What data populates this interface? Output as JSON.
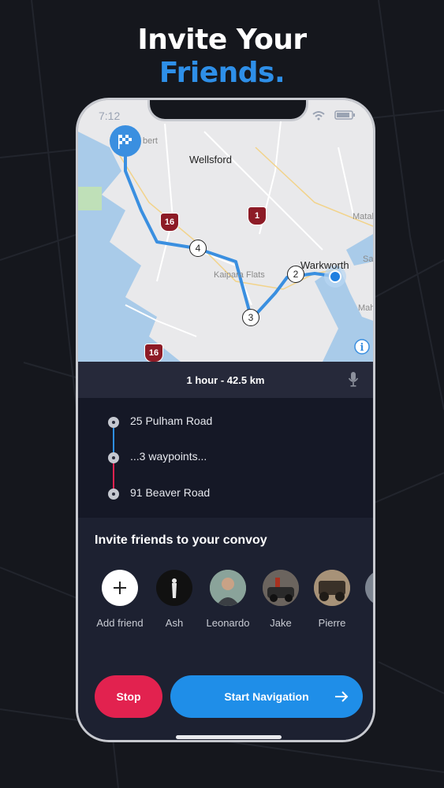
{
  "headline": {
    "line1": "Invite Your",
    "line2": "Friends."
  },
  "status_bar": {
    "time": "7:12"
  },
  "map": {
    "labels": {
      "wellsford": "Wellsford",
      "albert": "bert",
      "kaipara": "Kaipara Flats",
      "warkworth": "Warkworth",
      "matakana": "Matak",
      "sandspit": "Sa",
      "mahurangi": "Mah"
    },
    "shields": [
      "16",
      "1",
      "16"
    ],
    "waypoint_numbers": [
      "4",
      "2",
      "3"
    ]
  },
  "route": {
    "summary": "1 hour - 42.5 km"
  },
  "waypoints": [
    {
      "label": "25 Pulham Road"
    },
    {
      "label": "...3 waypoints..."
    },
    {
      "label": "91 Beaver Road"
    }
  ],
  "invite": {
    "title": "Invite friends to your convoy",
    "friends": [
      {
        "name": "Add friend"
      },
      {
        "name": "Ash"
      },
      {
        "name": "Leonardo"
      },
      {
        "name": "Jake"
      },
      {
        "name": "Pierre"
      }
    ]
  },
  "actions": {
    "stop": "Stop",
    "start": "Start Navigation"
  },
  "colors": {
    "accent_blue": "#2e8fe8",
    "stop_red": "#e2224f",
    "route_blue": "#3a8fe0"
  }
}
